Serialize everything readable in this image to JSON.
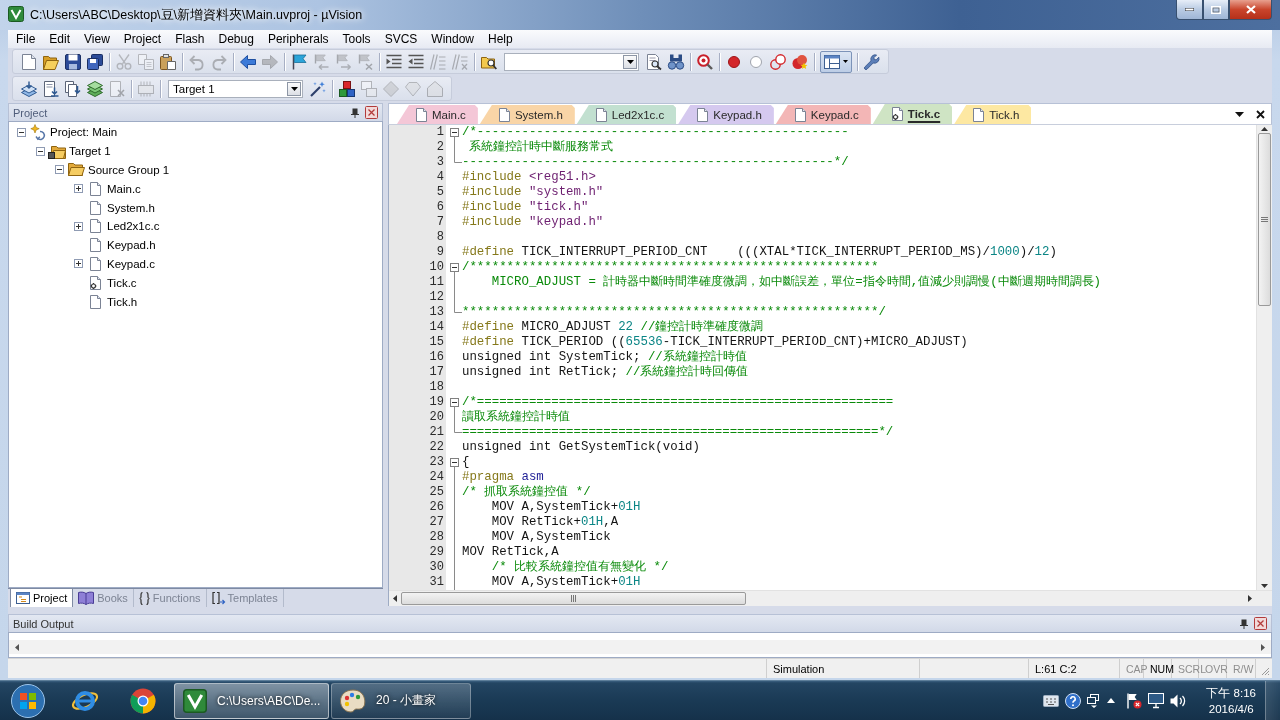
{
  "window": {
    "title": "C:\\Users\\ABC\\Desktop\\豆\\新增資料夾\\Main.uvproj - µVision"
  },
  "menu": [
    "File",
    "Edit",
    "View",
    "Project",
    "Flash",
    "Debug",
    "Peripherals",
    "Tools",
    "SVCS",
    "Window",
    "Help"
  ],
  "toolbar_1": [
    {
      "kind": "new",
      "disabled": false
    },
    {
      "kind": "open",
      "disabled": false
    },
    {
      "kind": "save",
      "disabled": false
    },
    {
      "kind": "save_all",
      "disabled": false
    },
    {
      "kind": "separator"
    },
    {
      "kind": "cut",
      "disabled": true
    },
    {
      "kind": "copy",
      "disabled": true
    },
    {
      "kind": "paste",
      "disabled": false
    },
    {
      "kind": "separator"
    },
    {
      "kind": "undo",
      "disabled": true
    },
    {
      "kind": "redo",
      "disabled": true
    },
    {
      "kind": "separator"
    },
    {
      "kind": "back",
      "disabled": false
    },
    {
      "kind": "forward",
      "disabled": true
    },
    {
      "kind": "separator"
    },
    {
      "kind": "bookmark",
      "disabled": false
    },
    {
      "kind": "prev_bookmark",
      "disabled": true
    },
    {
      "kind": "next_bookmark",
      "disabled": true
    },
    {
      "kind": "clear_bookmarks",
      "disabled": true
    },
    {
      "kind": "separator"
    },
    {
      "kind": "indent",
      "disabled": false
    },
    {
      "kind": "unindent",
      "disabled": false
    },
    {
      "kind": "comment",
      "disabled": true
    },
    {
      "kind": "uncomment",
      "disabled": true
    },
    {
      "kind": "separator"
    },
    {
      "kind": "find_in_files",
      "disabled": false
    },
    {
      "kind": "combo"
    },
    {
      "kind": "find",
      "disabled": false
    },
    {
      "kind": "incremental_find",
      "disabled": false
    },
    {
      "kind": "separator"
    },
    {
      "kind": "debug",
      "disabled": false
    },
    {
      "kind": "separator"
    },
    {
      "kind": "breakpoint",
      "disabled": false
    },
    {
      "kind": "disable_breakpoint",
      "disabled": false
    },
    {
      "kind": "kill_breakpoints",
      "disabled": false
    },
    {
      "kind": "kill_all",
      "disabled": false
    },
    {
      "kind": "separator"
    },
    {
      "kind": "layout",
      "disabled": false
    },
    {
      "kind": "separator"
    },
    {
      "kind": "configure",
      "disabled": false
    }
  ],
  "toolbar_2": [
    {
      "kind": "translate",
      "disabled": false
    },
    {
      "kind": "build",
      "disabled": false
    },
    {
      "kind": "rebuild",
      "disabled": false
    },
    {
      "kind": "batch_build",
      "disabled": false
    },
    {
      "kind": "stop_build",
      "disabled": true
    },
    {
      "kind": "separator"
    },
    {
      "kind": "download",
      "disabled": true
    },
    {
      "kind": "separator"
    },
    {
      "kind": "combo",
      "value": "Target 1"
    },
    {
      "kind": "options",
      "disabled": false
    },
    {
      "kind": "separator"
    },
    {
      "kind": "components",
      "disabled": false
    },
    {
      "kind": "environment",
      "disabled": true
    },
    {
      "kind": "diamond",
      "disabled": true
    },
    {
      "kind": "pack_installer",
      "disabled": true
    },
    {
      "kind": "pack_select",
      "disabled": true
    }
  ],
  "project_panel": {
    "title": "Project",
    "tree": [
      {
        "label": "Project: Main",
        "kind": "project",
        "expanded": true,
        "children": [
          {
            "label": "Target 1",
            "kind": "target",
            "expanded": true,
            "children": [
              {
                "label": "Source Group 1",
                "kind": "group",
                "expanded": true,
                "children": [
                  {
                    "label": "Main.c",
                    "kind": "file",
                    "expanded": false
                  },
                  {
                    "label": "System.h",
                    "kind": "file"
                  },
                  {
                    "label": "Led2x1c.c",
                    "kind": "file",
                    "expanded": false
                  },
                  {
                    "label": "Keypad.h",
                    "kind": "file"
                  },
                  {
                    "label": "Keypad.c",
                    "kind": "file",
                    "expanded": false
                  },
                  {
                    "label": "Tick.c",
                    "kind": "configured"
                  },
                  {
                    "label": "Tick.h",
                    "kind": "file"
                  }
                ]
              }
            ]
          }
        ]
      }
    ],
    "tabs": [
      {
        "label": "Project",
        "kind": "project",
        "selected": true
      },
      {
        "label": "Books",
        "kind": "books",
        "selected": false
      },
      {
        "label": "Functions",
        "kind": "functions",
        "selected": false
      },
      {
        "label": "Templates",
        "kind": "templates",
        "selected": false
      }
    ]
  },
  "editor": {
    "tabs": [
      {
        "label": "Main.c",
        "kind": "file",
        "color": "#f4c7d7",
        "selected": false
      },
      {
        "label": "System.h",
        "kind": "file",
        "color": "#f9d5a7",
        "selected": false
      },
      {
        "label": "Led2x1c.c",
        "kind": "file",
        "color": "#c2e0d0",
        "selected": false
      },
      {
        "label": "Keypad.h",
        "kind": "file",
        "color": "#d5c9ef",
        "selected": false
      },
      {
        "label": "Keypad.c",
        "kind": "file",
        "color": "#f3b6b6",
        "selected": false
      },
      {
        "label": "Tick.c",
        "kind": "configured",
        "color": "#cfe4c4",
        "selected": true
      },
      {
        "label": "Tick.h",
        "kind": "file",
        "color": "#fde8a2",
        "selected": false
      }
    ],
    "lines": [
      {
        "number": "1",
        "fold_start": true,
        "tokens": [
          {
            "kind": "comment",
            "text": "/*--------------------------------------------------"
          }
        ]
      },
      {
        "number": "2",
        "fold_inside": true,
        "tokens": [
          {
            "kind": "comment",
            "text": " 系統鐘控計時中斷服務常式"
          }
        ]
      },
      {
        "number": "3",
        "fold_end": true,
        "tokens": [
          {
            "kind": "comment",
            "text": "--------------------------------------------------*/"
          }
        ]
      },
      {
        "number": "4",
        "tokens": [
          {
            "kind": "preproc",
            "text": "#include"
          },
          {
            "kind": "string",
            "text": " <reg51.h>"
          }
        ]
      },
      {
        "number": "5",
        "tokens": [
          {
            "kind": "preproc",
            "text": "#include"
          },
          {
            "kind": "string",
            "text": " \"system.h\""
          }
        ]
      },
      {
        "number": "6",
        "tokens": [
          {
            "kind": "preproc",
            "text": "#include"
          },
          {
            "kind": "string",
            "text": " \"tick.h\""
          }
        ]
      },
      {
        "number": "7",
        "tokens": [
          {
            "kind": "preproc",
            "text": "#include"
          },
          {
            "kind": "string",
            "text": " \"keypad.h\""
          }
        ]
      },
      {
        "number": "8"
      },
      {
        "number": "9",
        "tokens": [
          {
            "kind": "preproc",
            "text": "#define"
          },
          {
            "kind": "text",
            "text": " TICK_INTERRUPT_PERIOD_CNT    (((XTAL*TICK_INTERRUPT_PERIOD_MS)/"
          },
          {
            "kind": "number",
            "text": "1000"
          },
          {
            "kind": "text",
            "text": ")/"
          },
          {
            "kind": "number",
            "text": "12"
          },
          {
            "kind": "text",
            "text": ")"
          }
        ]
      },
      {
        "number": "10",
        "fold_start": true,
        "tokens": [
          {
            "kind": "comment",
            "text": "/*******************************************************"
          }
        ]
      },
      {
        "number": "11",
        "fold_inside": true,
        "tokens": [
          {
            "kind": "comment",
            "text": "    MICRO_ADJUST = 計時器中斷時間準確度微調，如中斷誤差，單位=指令時間,值減少則調慢(中斷週期時間調長)"
          }
        ]
      },
      {
        "number": "12",
        "fold_inside": true
      },
      {
        "number": "13",
        "fold_end": true,
        "tokens": [
          {
            "kind": "comment",
            "text": "********************************************************/"
          }
        ]
      },
      {
        "number": "14",
        "tokens": [
          {
            "kind": "preproc",
            "text": "#define"
          },
          {
            "kind": "text",
            "text": " MICRO_ADJUST "
          },
          {
            "kind": "number",
            "text": "22"
          },
          {
            "kind": "comment",
            "text": " //鐘控計時準確度微調"
          }
        ]
      },
      {
        "number": "15",
        "tokens": [
          {
            "kind": "preproc",
            "text": "#define"
          },
          {
            "kind": "text",
            "text": " TICK_PERIOD (("
          },
          {
            "kind": "number",
            "text": "65536"
          },
          {
            "kind": "text",
            "text": "-TICK_INTERRUPT_PERIOD_CNT)+MICRO_ADJUST)"
          }
        ]
      },
      {
        "number": "16",
        "tokens": [
          {
            "kind": "text",
            "text": "unsigned int SystemTick; "
          },
          {
            "kind": "comment",
            "text": "//系統鐘控計時值"
          }
        ]
      },
      {
        "number": "17",
        "tokens": [
          {
            "kind": "text",
            "text": "unsigned int RetTick; "
          },
          {
            "kind": "comment",
            "text": "//系統鐘控計時回傳值"
          }
        ]
      },
      {
        "number": "18"
      },
      {
        "number": "19",
        "fold_start": true,
        "tokens": [
          {
            "kind": "comment",
            "text": "/*========================================================"
          }
        ]
      },
      {
        "number": "20",
        "fold_inside": true,
        "tokens": [
          {
            "kind": "comment",
            "text": "讀取系統鐘控計時值"
          }
        ]
      },
      {
        "number": "21",
        "fold_end": true,
        "tokens": [
          {
            "kind": "comment",
            "text": "========================================================*/"
          }
        ]
      },
      {
        "number": "22",
        "tokens": [
          {
            "kind": "text",
            "text": "unsigned int GetSystemTick(void)"
          }
        ]
      },
      {
        "number": "23",
        "fold_start": true,
        "tokens": [
          {
            "kind": "text",
            "text": "{"
          }
        ]
      },
      {
        "number": "24",
        "fold_inside": true,
        "tokens": [
          {
            "kind": "preproc",
            "text": "#pragma"
          },
          {
            "kind": "keyword",
            "text": " asm"
          }
        ]
      },
      {
        "number": "25",
        "fold_inside": true,
        "tokens": [
          {
            "kind": "comment",
            "text": "/* 抓取系統鐘控值 */"
          }
        ]
      },
      {
        "number": "26",
        "fold_inside": true,
        "tokens": [
          {
            "kind": "text",
            "text": "    MOV A,SystemTick+"
          },
          {
            "kind": "number",
            "text": "01H"
          }
        ]
      },
      {
        "number": "27",
        "fold_inside": true,
        "tokens": [
          {
            "kind": "text",
            "text": "    MOV RetTick+"
          },
          {
            "kind": "number",
            "text": "01H"
          },
          {
            "kind": "text",
            "text": ",A"
          }
        ]
      },
      {
        "number": "28",
        "fold_inside": true,
        "tokens": [
          {
            "kind": "text",
            "text": "    MOV A,SystemTick"
          }
        ]
      },
      {
        "number": "29",
        "fold_inside": true,
        "tokens": [
          {
            "kind": "text",
            "text": "MOV RetTick,A"
          }
        ]
      },
      {
        "number": "30",
        "fold_inside": true,
        "tokens": [
          {
            "kind": "comment",
            "text": "    /* 比較系統鐘控值有無變化 */"
          }
        ]
      },
      {
        "number": "31",
        "fold_inside": true,
        "tokens": [
          {
            "kind": "text",
            "text": "    MOV A,SystemTick+"
          },
          {
            "kind": "number",
            "text": "01H"
          }
        ]
      }
    ]
  },
  "build_output": {
    "title": "Build Output"
  },
  "status_bar": {
    "mode": "Simulation",
    "position": "L:61 C:2",
    "indicators": [
      {
        "label": "CAP",
        "on": false
      },
      {
        "label": "NUM",
        "on": true
      },
      {
        "label": "SCRL",
        "on": false
      },
      {
        "label": "OVR",
        "on": false
      },
      {
        "label": "R/W",
        "on": false
      }
    ]
  },
  "taskbar": {
    "tasks": [
      {
        "label": "C:\\Users\\ABC\\De...",
        "kind": "editor",
        "selected": true
      },
      {
        "label": "20 - 小畫家",
        "kind": "paint",
        "selected": false
      }
    ],
    "clock": {
      "time": "下午 8:16",
      "date": "2016/4/6"
    }
  }
}
